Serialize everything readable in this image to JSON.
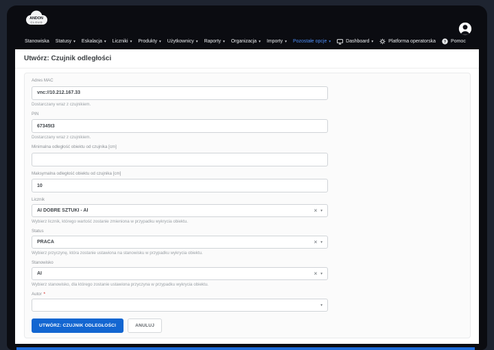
{
  "colors": {
    "accent_link": "#4d8df6",
    "primary_button": "#1366d1",
    "bottom_strip": "#1d6bd8",
    "required_marker": "#d9534f"
  },
  "brand": {
    "top": "ANDON",
    "bottom": "CLOUD"
  },
  "navbar": {
    "items": [
      {
        "label": "Stanowiska",
        "has_menu": false
      },
      {
        "label": "Statusy",
        "has_menu": true
      },
      {
        "label": "Eskalacja",
        "has_menu": true
      },
      {
        "label": "Liczniki",
        "has_menu": true
      },
      {
        "label": "Produkty",
        "has_menu": true
      },
      {
        "label": "Użytkownicy",
        "has_menu": true
      },
      {
        "label": "Raporty",
        "has_menu": true
      },
      {
        "label": "Organizacja",
        "has_menu": true
      },
      {
        "label": "Importy",
        "has_menu": true
      },
      {
        "label": "Pozostałe opcje",
        "has_menu": true,
        "highlighted": true
      },
      {
        "label": "Dashboard",
        "has_menu": true,
        "icon": "monitor-icon"
      },
      {
        "label": "Platforma operatorska",
        "has_menu": false,
        "icon": "cogs-icon"
      },
      {
        "label": "Pomoc",
        "has_menu": false,
        "icon": "question-icon"
      }
    ]
  },
  "page": {
    "title": "Utwórz: Czujnik odległości"
  },
  "form": {
    "fields": [
      {
        "label": "Adres MAC",
        "type": "text",
        "value": "vnc://10.212.167.33",
        "help": "Dostarczany wraz z czujnikiem."
      },
      {
        "label": "PIN",
        "type": "text",
        "value": "67345t3",
        "help": "Dostarczany wraz z czujnikiem."
      },
      {
        "label": "Minimalna odległość obiektu od czujnika [cm]",
        "type": "text",
        "value": ""
      },
      {
        "label": "Maksymalna odległość obiektu od czujnika [cm]",
        "type": "text",
        "value": "10"
      },
      {
        "label": "Licznik",
        "type": "select",
        "value": "AI DOBRE SZTUKI - AI",
        "clearable": true,
        "help": "Wybierz licznik, którego wartość zostanie zmieniona w przypadku wykrycia obiektu."
      },
      {
        "label": "Status",
        "type": "select",
        "value": "PRACA",
        "clearable": true,
        "help": "Wybierz przyczynę, która zostanie ustawiona na stanowisku w przypadku wykrycia obiektu."
      },
      {
        "label": "Stanowisko",
        "type": "select",
        "value": "AI",
        "clearable": true,
        "help": "Wybierz stanowisko, dla którego zostanie ustawiona przyczyna w przypadku wykrycia obiektu."
      },
      {
        "label": "Autor",
        "type": "select",
        "value": "",
        "required": true,
        "clearable": false
      }
    ],
    "required_marker": "*",
    "submit_label": "UTWÓRZ: CZUJNIK ODLEGŁOŚCI",
    "cancel_label": "ANULUJ"
  },
  "icons": {
    "caret": "▾",
    "clear": "×",
    "question": "?"
  }
}
